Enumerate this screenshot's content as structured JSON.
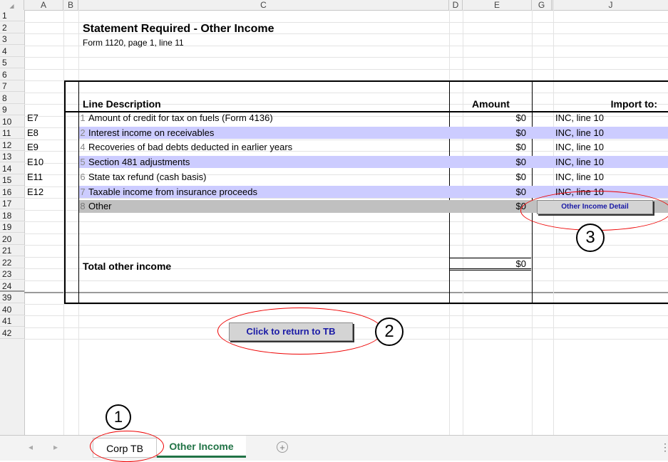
{
  "columns": [
    "A",
    "B",
    "C",
    "D",
    "E",
    "G",
    "J"
  ],
  "rows": [
    "1",
    "2",
    "3",
    "4",
    "5",
    "6",
    "7",
    "8",
    "9",
    "10",
    "11",
    "12",
    "13",
    "14",
    "15",
    "16",
    "17",
    "18",
    "19",
    "20",
    "21",
    "22",
    "23",
    "24",
    "39",
    "40",
    "41",
    "42"
  ],
  "sheet": {
    "title": "Statement Required - Other Income",
    "subtitle": "Form 1120, page 1, line 11",
    "headers": {
      "description": "Line Description",
      "amount": "Amount",
      "import_to": "Import to:"
    },
    "lines": [
      {
        "ref": "E7",
        "num": "1",
        "desc": "Amount of credit for tax on fuels (Form 4136)",
        "amount": "$0",
        "import": "INC, line 10"
      },
      {
        "ref": "E8",
        "num": "2",
        "desc": "Interest income on receivables",
        "amount": "$0",
        "import": "INC, line 10"
      },
      {
        "ref": "E9",
        "num": "4",
        "desc": "Recoveries of bad debts deducted in earlier years",
        "amount": "$0",
        "import": "INC, line 10"
      },
      {
        "ref": "E10",
        "num": "5",
        "desc": "Section 481 adjustments",
        "amount": "$0",
        "import": "INC, line 10"
      },
      {
        "ref": "E11",
        "num": "6",
        "desc": "State tax refund (cash basis)",
        "amount": "$0",
        "import": "INC, line 10"
      },
      {
        "ref": "E12",
        "num": "7",
        "desc": "Taxable income from insurance proceeds",
        "amount": "$0",
        "import": "INC, line 10"
      }
    ],
    "other": {
      "num": "8",
      "desc": "Other",
      "amount": "$0"
    },
    "total": {
      "label": "Total other income",
      "amount": "$0"
    }
  },
  "buttons": {
    "detail": "Other Income Detail",
    "return_tb": "Click to return to TB"
  },
  "callouts": [
    "1",
    "2",
    "3"
  ],
  "tabs": {
    "prev": "◂",
    "next": "▸",
    "items": [
      "Corp TB",
      "Other Income"
    ],
    "active": "Other Income",
    "add": "+",
    "more": "⋮"
  },
  "colors": {
    "band": "#ccccff",
    "other_row": "#c0c0c0",
    "active_tab": "#217346",
    "callout": "#e00000",
    "button_text": "#1a1aa6"
  }
}
